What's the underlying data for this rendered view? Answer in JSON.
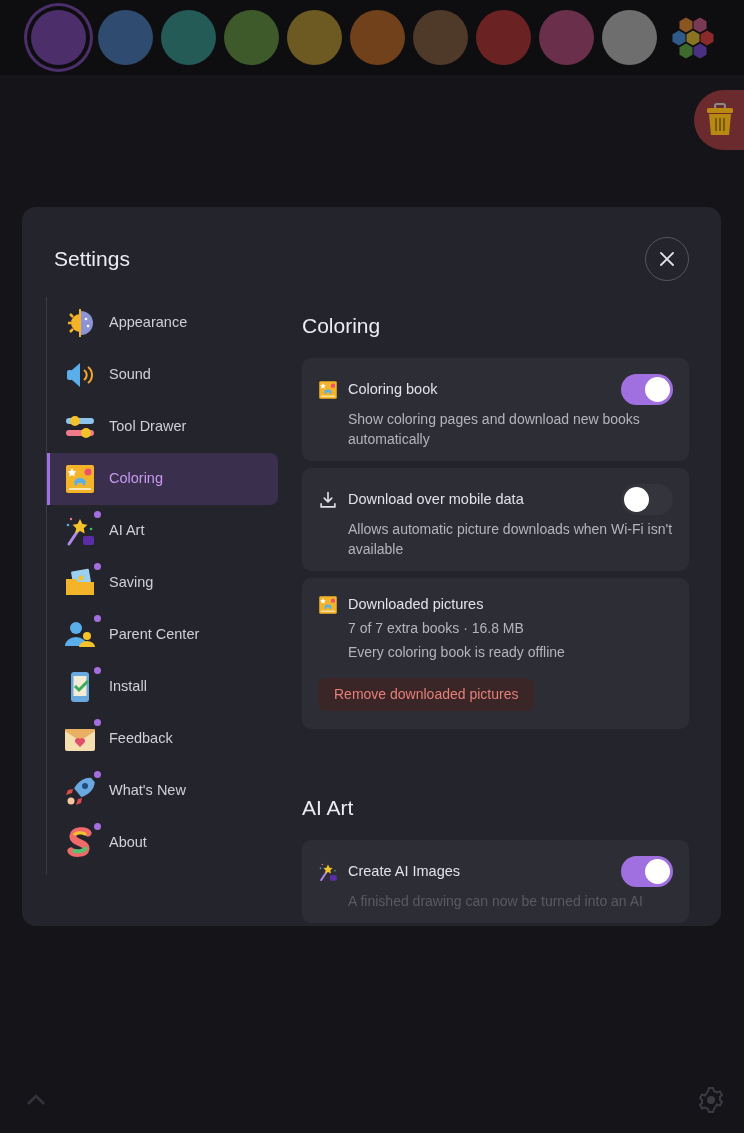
{
  "palette": [
    {
      "color": "#4c2e6a",
      "selected": true
    },
    {
      "color": "#2f4b70",
      "selected": false
    },
    {
      "color": "#245b57",
      "selected": false
    },
    {
      "color": "#3e5a2b",
      "selected": false
    },
    {
      "color": "#6c5a22",
      "selected": false
    },
    {
      "color": "#71411b",
      "selected": false
    },
    {
      "color": "#4f3a2a",
      "selected": false
    },
    {
      "color": "#6a2222",
      "selected": false
    },
    {
      "color": "#6a2f4a",
      "selected": false
    },
    {
      "color": "#6e6e6e",
      "selected": false
    }
  ],
  "settings": {
    "title": "Settings",
    "sidebar": {
      "items": [
        {
          "label": "Appearance",
          "kind": "appearance",
          "selected": false,
          "badge": false
        },
        {
          "label": "Sound",
          "kind": "sound",
          "selected": false,
          "badge": false
        },
        {
          "label": "Tool Drawer",
          "kind": "tools",
          "selected": false,
          "badge": false
        },
        {
          "label": "Coloring",
          "kind": "coloring",
          "selected": true,
          "badge": false
        },
        {
          "label": "AI Art",
          "kind": "ai",
          "selected": false,
          "badge": true
        },
        {
          "label": "Saving",
          "kind": "saving",
          "selected": false,
          "badge": true
        },
        {
          "label": "Parent Center",
          "kind": "parents",
          "selected": false,
          "badge": true
        },
        {
          "label": "Install",
          "kind": "install",
          "selected": false,
          "badge": true
        },
        {
          "label": "Feedback",
          "kind": "feedback",
          "selected": false,
          "badge": true
        },
        {
          "label": "What's New",
          "kind": "news",
          "selected": false,
          "badge": true
        },
        {
          "label": "About",
          "kind": "about",
          "selected": false,
          "badge": true
        }
      ]
    },
    "sections": [
      {
        "heading": "Coloring",
        "cards": [
          {
            "kind": "book_toggle",
            "title": "Coloring book",
            "on": true,
            "description": "Show coloring pages and download new books automatically"
          },
          {
            "kind": "download_toggle",
            "title": "Download over mobile data",
            "on": false,
            "description": "Allows automatic picture downloads when Wi-Fi isn't available"
          },
          {
            "kind": "storage",
            "title": "Downloaded pictures",
            "lines": [
              "7 of 7 extra books · 16.8 MB",
              "Every coloring book is ready offline"
            ],
            "button": "Remove downloaded pictures"
          }
        ]
      },
      {
        "heading": "AI Art",
        "cards": [
          {
            "kind": "ai_toggle",
            "title": "Create AI Images",
            "on": true,
            "description": "A finished drawing can now be turned into an AI"
          }
        ]
      }
    ]
  }
}
